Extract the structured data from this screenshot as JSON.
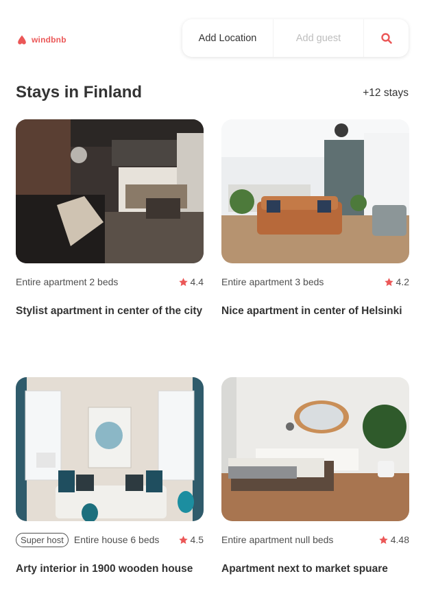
{
  "header": {
    "logo_text": "windbnb",
    "search": {
      "location_label": "Add Location",
      "guest_placeholder": "Add guest"
    }
  },
  "main": {
    "title": "Stays in Finland",
    "count": "+12 stays"
  },
  "stays": [
    {
      "type": "Entire apartment 2 beds",
      "rating": "4.4",
      "title": "Stylist apartment in center of the city",
      "superhost": false
    },
    {
      "type": "Entire apartment 3 beds",
      "rating": "4.2",
      "title": "Nice apartment in center of Helsinki",
      "superhost": false
    },
    {
      "type": "Entire house 6 beds",
      "rating": "4.5",
      "title": "Arty interior in 1900 wooden house",
      "superhost": true,
      "badge": "Super host"
    },
    {
      "type": "Entire apartment null beds",
      "rating": "4.48",
      "title": "Apartment next to market spuare",
      "superhost": false
    }
  ],
  "colors": {
    "accent": "#eb5757",
    "text": "#333333",
    "muted": "#bdbdbd"
  }
}
